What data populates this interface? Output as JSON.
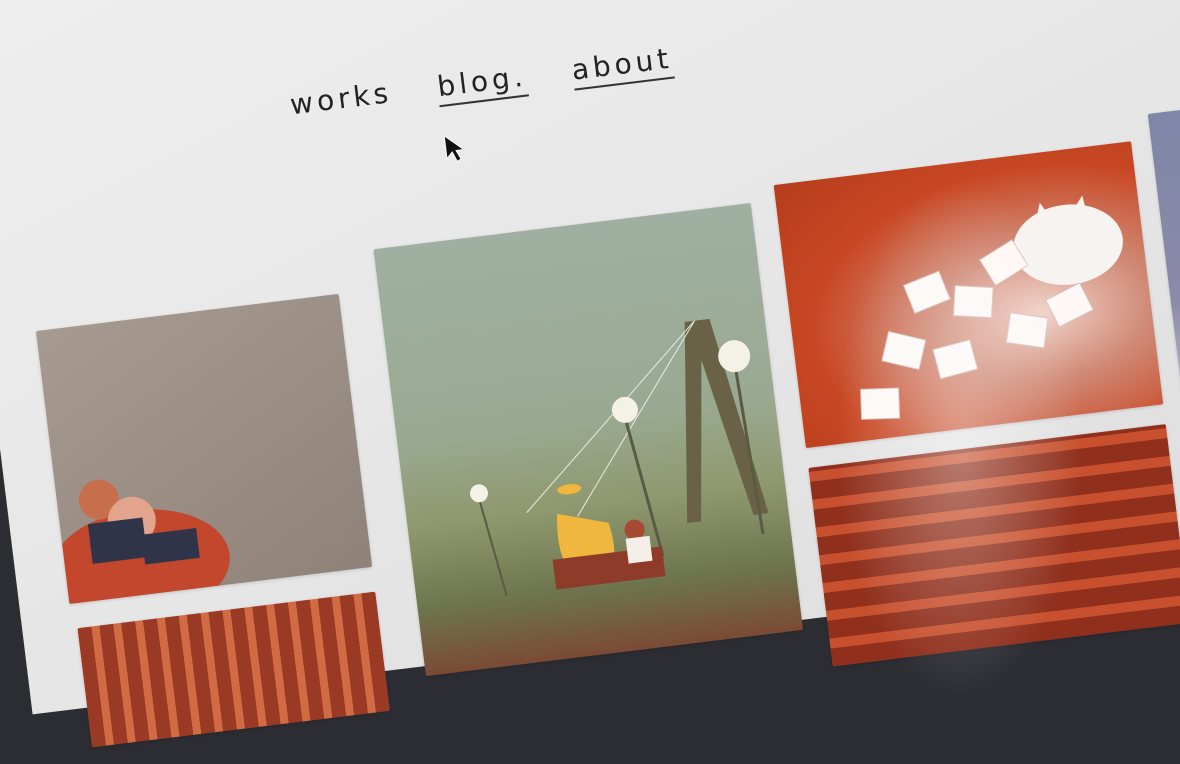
{
  "nav": {
    "items": [
      {
        "label": "works"
      },
      {
        "label": "blog."
      },
      {
        "label": "about"
      }
    ]
  },
  "gallery": {
    "tiles": [
      {
        "name": "illustration-couple"
      },
      {
        "name": "illustration-park-lamps"
      },
      {
        "name": "illustration-cat-photos"
      },
      {
        "name": "illustration-bookshelves"
      },
      {
        "name": "illustration-blue-texture"
      },
      {
        "name": "illustration-crowd"
      }
    ]
  }
}
